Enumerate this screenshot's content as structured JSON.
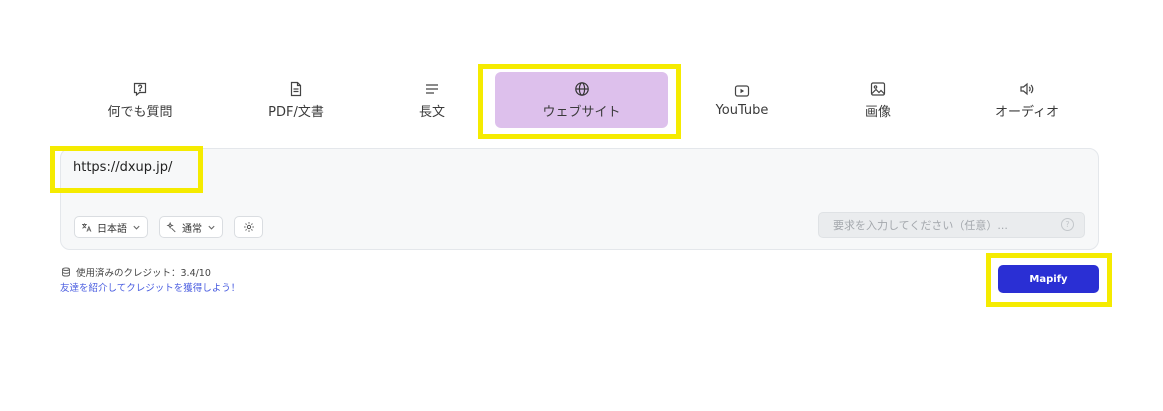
{
  "tabs": [
    {
      "label": "何でも質問",
      "icon": "message-question-icon"
    },
    {
      "label": "PDF/文書",
      "icon": "document-icon"
    },
    {
      "label": "長文",
      "icon": "text-lines-icon"
    },
    {
      "label": "ウェブサイト",
      "icon": "globe-icon",
      "active": true
    },
    {
      "label": "YouTube",
      "icon": "youtube-play-icon"
    },
    {
      "label": "画像",
      "icon": "image-icon"
    },
    {
      "label": "オーディオ",
      "icon": "speaker-icon"
    }
  ],
  "input": {
    "url_value": "https://dxup.jp/",
    "language_label": "日本語",
    "mode_label": "通常",
    "prompt_placeholder": "要求を入力してください（任意）..."
  },
  "footer": {
    "credits_text": "使用済みのクレジット：3.4/10",
    "referral_link": "友達を紹介してクレジットを獲得しよう！"
  },
  "submit_label": "Mapify",
  "colors": {
    "active_tab_bg": "#ddc0ec",
    "highlight_border": "#f5eb00",
    "primary_button": "#2a2fd4",
    "link": "#4a5de0"
  }
}
